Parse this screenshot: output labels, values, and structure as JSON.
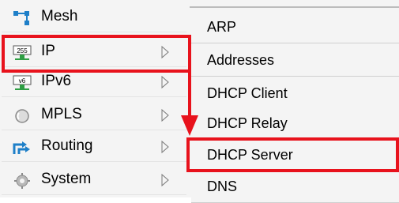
{
  "left_menu": {
    "items": [
      {
        "label": "Mesh",
        "icon": "mesh-icon"
      },
      {
        "label": "IP",
        "icon": "ip-255-icon"
      },
      {
        "label": "IPv6",
        "icon": "ipv6-icon"
      },
      {
        "label": "MPLS",
        "icon": "mpls-icon"
      },
      {
        "label": "Routing",
        "icon": "routing-icon"
      },
      {
        "label": "System",
        "icon": "gear-icon"
      }
    ]
  },
  "submenu": {
    "items": [
      "ARP",
      "Addresses",
      "DHCP Client",
      "DHCP Relay",
      "DHCP Server",
      "DNS"
    ]
  },
  "colors": {
    "annotation_red": "#e8121c"
  }
}
